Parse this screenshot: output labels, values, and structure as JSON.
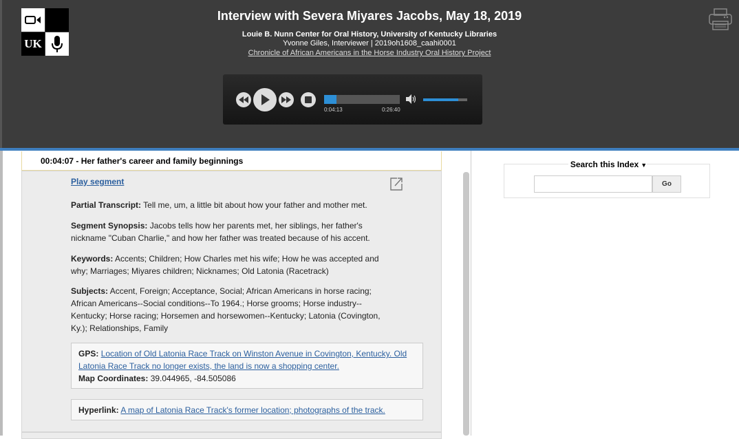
{
  "header": {
    "title": "Interview with Severa Miyares Jacobs, May 18, 2019",
    "institution": "Louie B. Nunn Center for Oral History, University of Kentucky Libraries",
    "interviewer_line": "Yvonne Giles, Interviewer | 2019oh1608_caahi0001",
    "project_link": "Chronicle of African Americans in the Horse Industry Oral History Project",
    "logo_text": "UK"
  },
  "player": {
    "current_time": "0:04:13",
    "duration": "0:26:40",
    "progress_fraction": 0.16,
    "volume_fraction": 0.8
  },
  "segment": {
    "heading": "00:04:07 - Her father's career and family beginnings",
    "play_label": "Play segment",
    "partial_label": "Partial Transcript:",
    "partial_text": "Tell me, um, a little bit about how your father and mother met.",
    "synopsis_label": "Segment Synopsis:",
    "synopsis_text": "Jacobs tells how her parents met, her siblings, her father's nickname \"Cuban Charlie,\" and how her father was treated because of his accent.",
    "keywords_label": "Keywords:",
    "keywords_text": "Accents; Children; How Charles met his wife; How he was accepted and why; Marriages; Miyares children; Nicknames; Old Latonia (Racetrack)",
    "subjects_label": "Subjects:",
    "subjects_text": "Accent, Foreign; Acceptance, Social; African Americans in horse racing; African Americans--Social conditions--To 1964.; Horse grooms; Horse industry--Kentucky; Horse racing; Horsemen and horsewomen--Kentucky; Latonia (Covington, Ky.); Relationships, Family",
    "gps_label": "GPS:",
    "gps_link": "Location of Old Latonia Race Track on Winston Avenue in Covington, Kentucky. Old Latonia Race Track no longer exists, the land is now a shopping center.",
    "coords_label": "Map Coordinates:",
    "coords_value": "39.044965, -84.505086",
    "hyperlink_label": "Hyperlink:",
    "hyperlink_text": "A map of Latonia Race Track's former location; photographs of the track."
  },
  "search": {
    "label": "Search this Index",
    "go_label": "Go",
    "placeholder": ""
  },
  "colors": {
    "header_bg": "#3c3c3c",
    "accent_blue": "#3f7fbf",
    "link": "#2b5f9e"
  }
}
